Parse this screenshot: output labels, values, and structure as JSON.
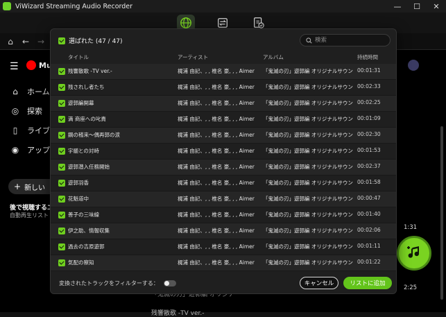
{
  "window": {
    "title": "ViWizard Streaming Audio Recorder",
    "minimize": "—",
    "maximize": "☐",
    "close": "✕"
  },
  "background": {
    "logo_text": "Music",
    "sidebar": [
      {
        "label": "ホーム"
      },
      {
        "label": "探索"
      },
      {
        "label": "ライブラリ"
      },
      {
        "label": "アップグレード"
      }
    ],
    "new_playlist": "新しい",
    "watch_later_title": "後で視聴するエ",
    "watch_later_sub": "自動再生リスト",
    "time_a": "1:31",
    "time_b": "2:25",
    "bottom_text_a": "「鬼滅の刃」遊郭編 オリジナ",
    "bottom_text_b": "残響散歌 -TV ver.-"
  },
  "dialog": {
    "select_all_label": "選ばれた (47 / 47)",
    "search_placeholder": "検索",
    "columns": {
      "title": "タイトル",
      "artist": "アーティスト",
      "album": "アルバム",
      "duration": "持続時間"
    },
    "tracks": [
      {
        "title": "残響散歌 -TV ver.-",
        "artist": "梶浦 由記、, , 椎名 豪, , , Aimer",
        "album": "「鬼滅の刃」遊郭編 オリジナルサウン...",
        "duration": "00:01:31"
      },
      {
        "title": "残されし者たち",
        "artist": "梶浦 由記、, , 椎名 豪, , , Aimer",
        "album": "「鬼滅の刃」遊郭編 オリジナルサウン...",
        "duration": "00:02:33"
      },
      {
        "title": "遊郭編開幕",
        "artist": "梶浦 由記、, , 椎名 豪, , , Aimer",
        "album": "「鬼滅の刃」遊郭編 オリジナルサウン...",
        "duration": "00:02:25"
      },
      {
        "title": "満 商座への叱責",
        "artist": "梶浦 由記、, , 椎名 豪, , , Aimer",
        "album": "「鬼滅の刃」遊郭編 オリジナルサウン...",
        "duration": "00:01:09"
      },
      {
        "title": "鋼の稽来〜偶再郭の涙",
        "artist": "梶浦 由記、, , 椎名 豪, , , Aimer",
        "album": "「鬼滅の刃」遊郭編 オリジナルサウン...",
        "duration": "00:02:30"
      },
      {
        "title": "宇髄との対峙",
        "artist": "梶浦 由記、, , 椎名 豪, , , Aimer",
        "album": "「鬼滅の刃」遊郭編 オリジナルサウン...",
        "duration": "00:01:53"
      },
      {
        "title": "遊郭潜入任務開始",
        "artist": "梶浦 由記、, , 椎名 豪, , , Aimer",
        "album": "「鬼滅の刃」遊郭編 オリジナルサウン...",
        "duration": "00:02:37"
      },
      {
        "title": "遊郭羽香",
        "artist": "梶浦 由記、, , 椎名 豪, , , Aimer",
        "album": "「鬼滅の刃」遊郭編 オリジナルサウン...",
        "duration": "00:01:58"
      },
      {
        "title": "花魁道中",
        "artist": "梶浦 由記、, , 椎名 豪, , , Aimer",
        "album": "「鬼滅の刃」遊郭編 オリジナルサウン...",
        "duration": "00:00:47"
      },
      {
        "title": "善子の三味線",
        "artist": "梶浦 由記、, , 椎名 豪, , , Aimer",
        "album": "「鬼滅の刃」遊郭編 オリジナルサウン...",
        "duration": "00:01:40"
      },
      {
        "title": "伊之助、情報収集",
        "artist": "梶浦 由記、, , 椎名 豪, , , Aimer",
        "album": "「鬼滅の刃」遊郭編 オリジナルサウン...",
        "duration": "00:02:06"
      },
      {
        "title": "過去の吉原遊郭",
        "artist": "梶浦 由記、, , 椎名 豪, , , Aimer",
        "album": "「鬼滅の刃」遊郭編 オリジナルサウン...",
        "duration": "00:01:11"
      },
      {
        "title": "気配の察知",
        "artist": "梶浦 由記、, , 椎名 豪, , , Aimer",
        "album": "「鬼滅の刃」遊郭編 オリジナルサウン...",
        "duration": "00:01:22"
      }
    ],
    "filter_label": "変換されたトラックをフィルターする：",
    "cancel_label": "キャンセル",
    "add_label": "リストに追加"
  },
  "colors": {
    "accent": "#6fcf1f",
    "dialog_bg": "#1f1f1f",
    "row_alt": "#262626"
  }
}
